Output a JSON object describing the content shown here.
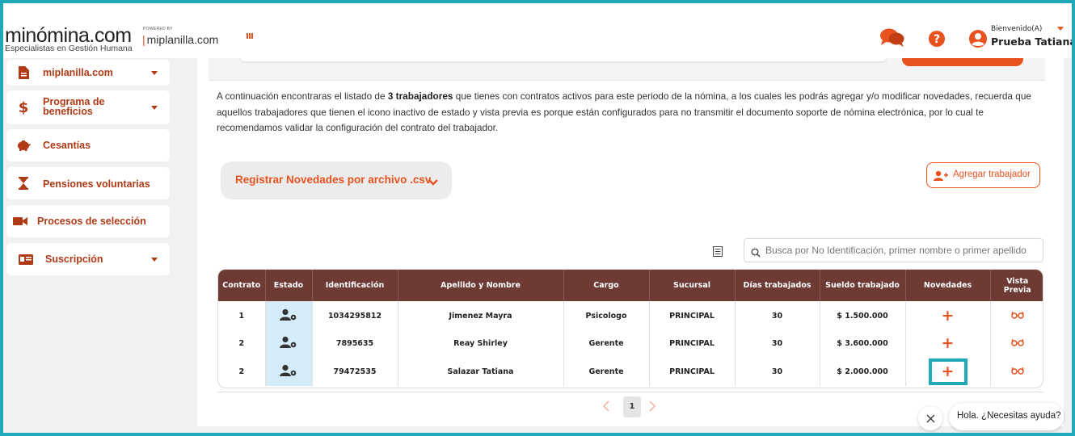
{
  "header": {
    "logo_text": "minómina.com",
    "logo_tagline": "Especialistas en Gestión Humana",
    "powered_label": "POWERED BY",
    "powered_brand": "miplanilla.com",
    "welcome": "Bienvenido(A)",
    "user_name": "Prueba Tatiana"
  },
  "sidebar": {
    "items": [
      {
        "label": "miplanilla.com",
        "icon": "document-icon",
        "caret": true
      },
      {
        "label": "Programa de beneficios",
        "label_line1": "Programa de",
        "label_line2": "beneficios",
        "icon": "dollar-icon",
        "caret": true
      },
      {
        "label": "Cesantías",
        "icon": "piggy-bank-icon",
        "caret": false
      },
      {
        "label": "Pensiones voluntarias",
        "icon": "hourglass-icon",
        "caret": false
      },
      {
        "label": "Procesos de selección",
        "icon": "video-camera-icon",
        "caret": false
      },
      {
        "label": "Suscripción",
        "icon": "id-card-icon",
        "caret": true
      }
    ]
  },
  "main": {
    "intro_pre": "A continuación encontraras el listado de ",
    "intro_bold": "3 trabajadores",
    "intro_post": " que tienes con contratos activos para este periodo de la nómina, a los cuales les podrás agregar y/o modificar novedades, recuerda que aquellos trabajadores que tienen el icono inactivo de estado y vista previa es porque están configurados para no transmitir el documento soporte de nómina electrónica, por lo cual te recomendamos validar la configuración del contrato del trabajador.",
    "csv_button": "Registrar Novedades por archivo .csv",
    "add_worker_button": "Agregar trabajador",
    "search_placeholder": "Busca por No Identificación, primer nombre o primer apellido"
  },
  "table": {
    "headers": {
      "contrato": "Contrato",
      "estado": "Estado",
      "identificacion": "Identificación",
      "nombre": "Apellido y Nombre",
      "cargo": "Cargo",
      "sucursal": "Sucursal",
      "dias": "Días trabajados",
      "sueldo": "Sueldo trabajado",
      "novedades": "Novedades",
      "vista_line1": "Vista",
      "vista_line2": "Previa"
    },
    "rows": [
      {
        "contrato": "1",
        "identificacion": "1034295812",
        "nombre": "Jimenez Mayra",
        "cargo": "Psicologo",
        "sucursal": "PRINCIPAL",
        "dias": "30",
        "sueldo": "$ 1.500.000",
        "novedades": "+"
      },
      {
        "contrato": "2",
        "identificacion": "7895635",
        "nombre": "Reay Shirley",
        "cargo": "Gerente",
        "sucursal": "PRINCIPAL",
        "dias": "30",
        "sueldo": "$ 3.600.000",
        "novedades": "+"
      },
      {
        "contrato": "2",
        "identificacion": "79472535",
        "nombre": "Salazar Tatiana",
        "cargo": "Gerente",
        "sucursal": "PRINCIPAL",
        "dias": "30",
        "sueldo": "$ 2.000.000",
        "novedades": "+"
      }
    ]
  },
  "pagination": {
    "current": "1"
  },
  "chat": {
    "text": "Hola. ¿Necesitas ayuda?"
  },
  "colors": {
    "accent": "#e8521f",
    "brand_dark": "#6d3a34",
    "highlight": "#1fa9b8",
    "sidebar_text": "#b13a16"
  }
}
